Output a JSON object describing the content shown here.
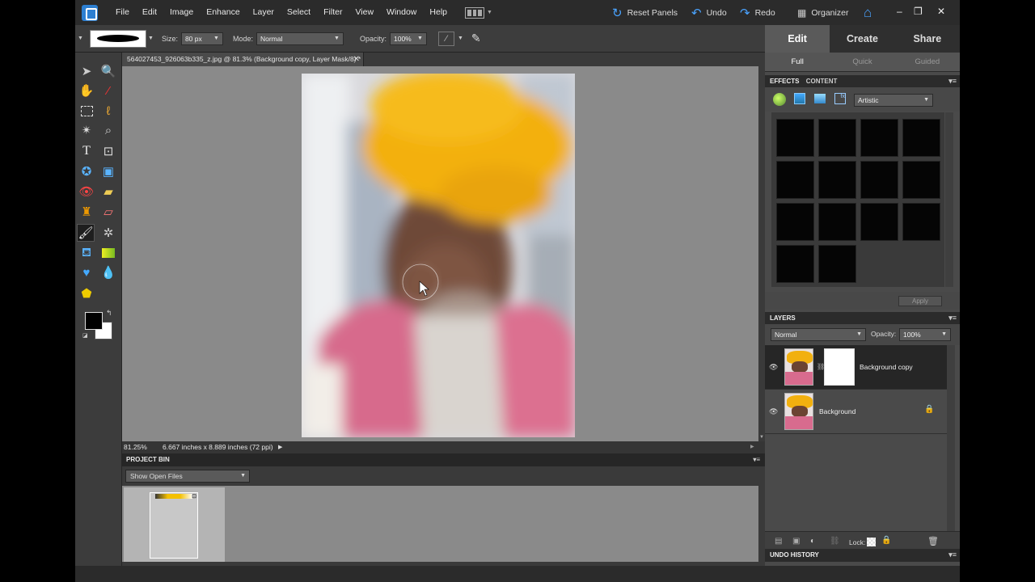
{
  "menubar": {
    "items": [
      "File",
      "Edit",
      "Image",
      "Enhance",
      "Layer",
      "Select",
      "Filter",
      "View",
      "Window",
      "Help"
    ],
    "reset_panels": "Reset Panels",
    "undo": "Undo",
    "redo": "Redo",
    "organizer": "Organizer"
  },
  "options": {
    "size_label": "Size:",
    "size_value": "80 px",
    "mode_label": "Mode:",
    "mode_value": "Normal",
    "opacity_label": "Opacity:",
    "opacity_value": "100%"
  },
  "document": {
    "tab_title": "564027453_926063b335_z.jpg @ 81.3% (Background copy, Layer Mask/8) *",
    "zoom": "81.25%",
    "dimensions": "6.667 inches x 8.889 inches (72 ppi)"
  },
  "project_bin": {
    "title": "PROJECT BIN",
    "selector": "Show Open Files"
  },
  "modes": {
    "tabs": [
      "Edit",
      "Create",
      "Share"
    ],
    "sub_tabs": [
      "Full",
      "Quick",
      "Guided"
    ]
  },
  "effects": {
    "tab_effects": "EFFECTS",
    "tab_content": "CONTENT",
    "category": "Artistic",
    "apply": "Apply",
    "thumbnail_count": 14
  },
  "layers": {
    "title": "LAYERS",
    "blend_mode": "Normal",
    "opacity_label": "Opacity:",
    "opacity_value": "100%",
    "items": [
      {
        "name": "Background copy",
        "selected": true,
        "has_mask": true,
        "locked": false
      },
      {
        "name": "Background",
        "selected": false,
        "has_mask": false,
        "locked": true
      }
    ],
    "lock_label": "Lock:"
  },
  "undo_history": {
    "title": "UNDO HISTORY"
  }
}
